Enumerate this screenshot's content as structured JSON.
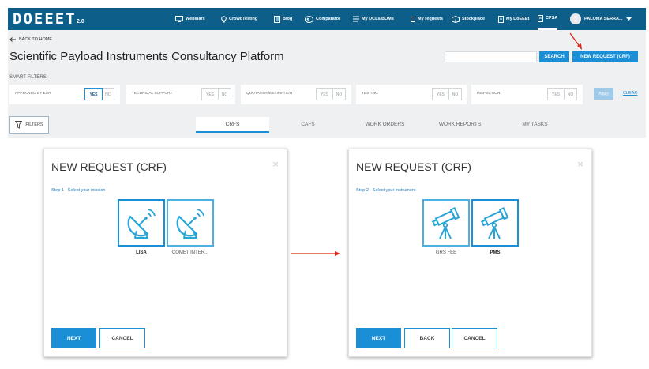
{
  "app": {
    "logo": "DOEEET",
    "version": "2.0"
  },
  "nav": {
    "items": [
      {
        "label": "Webinars",
        "icon": "monitor-icon"
      },
      {
        "label": "CrowdTesting",
        "icon": "lightbulb-icon"
      },
      {
        "label": "Blog",
        "icon": "document-icon"
      },
      {
        "label": "Comparator",
        "icon": "compare-icon"
      },
      {
        "label": "My DCLs/BOMs",
        "icon": "list-icon"
      },
      {
        "label": "My requests",
        "icon": "requests-icon"
      },
      {
        "label": "Stockplace",
        "icon": "box-icon"
      },
      {
        "label": "My DoEEEt",
        "icon": "file-icon"
      },
      {
        "label": "CPSA",
        "icon": "file-icon",
        "active": true
      }
    ],
    "user": {
      "name": "PALOMA SERRA..."
    }
  },
  "header": {
    "back_label": "BACK TO HOME",
    "title": "Scientific Payload Instruments Consultancy Platform",
    "search_placeholder": "",
    "search_button": "SEARCH",
    "new_request_button": "NEW REQUEST (CRF)"
  },
  "smart_filters": {
    "title": "SMART FILTERS",
    "filters": [
      {
        "label": "APPROVED BY ESA",
        "yes": "YES",
        "no": "NO",
        "selected": "YES"
      },
      {
        "label": "TECHNICAL SUPPORT",
        "yes": "YES",
        "no": "NO",
        "selected": ""
      },
      {
        "label": "QUOTATION/ESTIMATION",
        "yes": "YES",
        "no": "NO",
        "selected": ""
      },
      {
        "label": "TESTING",
        "yes": "YES",
        "no": "NO",
        "selected": ""
      },
      {
        "label": "INSPECTION",
        "yes": "YES",
        "no": "NO",
        "selected": ""
      }
    ],
    "apply": "Apply",
    "clear": "CLEAR"
  },
  "filters_button": "FILTERS",
  "tabs": [
    {
      "label": "CRFS",
      "active": true
    },
    {
      "label": "CAFS",
      "active": false
    },
    {
      "label": "WORK ORDERS",
      "active": false
    },
    {
      "label": "WORK REPORTS",
      "active": false
    },
    {
      "label": "MY TASKS",
      "active": false
    }
  ],
  "modal1": {
    "title": "NEW REQUEST (CRF)",
    "close": "×",
    "step": "Step 1 · Select your mission",
    "options": [
      {
        "label": "LISA",
        "icon": "satellite-dish-icon",
        "selected": true
      },
      {
        "label": "COMET INTER...",
        "icon": "satellite-dish-icon",
        "selected": false
      }
    ],
    "next": "NEXT",
    "cancel": "CANCEL"
  },
  "modal2": {
    "title": "NEW REQUEST (CRF)",
    "close": "×",
    "step": "Step 2 · Select your instrument",
    "options": [
      {
        "label": "GRS FEE",
        "icon": "telescope-icon",
        "selected": false
      },
      {
        "label": "PMS",
        "icon": "telescope-icon",
        "selected": true
      }
    ],
    "next": "NEXT",
    "back": "BACK",
    "cancel": "CANCEL"
  },
  "colors": {
    "nav_bg": "#0d5f8a",
    "accent": "#1a8fd6",
    "band_bg": "#eef0f2",
    "annotation_arrow": "#e0251b"
  }
}
